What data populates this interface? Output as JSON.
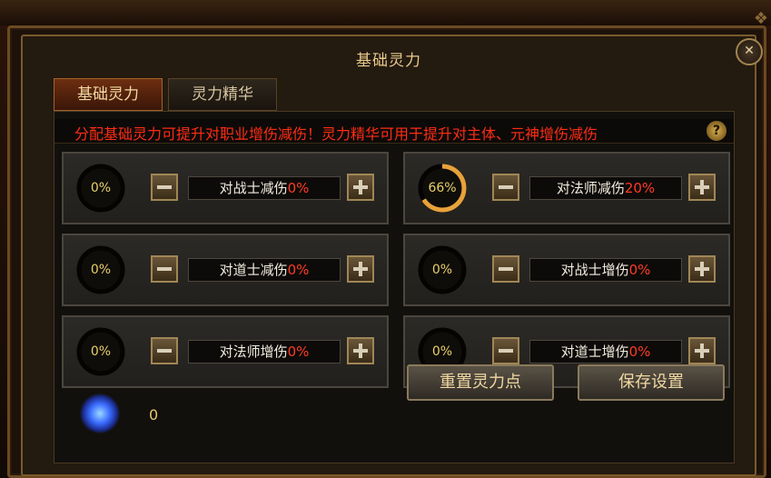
{
  "window": {
    "title": "基础灵力",
    "close_symbol": "✕"
  },
  "tabs": [
    {
      "label": "基础灵力",
      "active": true
    },
    {
      "label": "灵力精华",
      "active": false
    }
  ],
  "hint": {
    "text": "分配基础灵力可提升对职业增伤减伤！灵力精华可用于提升对主体、元神增伤减伤",
    "help_symbol": "?"
  },
  "stats": [
    {
      "percent_text": "0%",
      "progress": 0,
      "label": "对战士减伤",
      "value": "0%"
    },
    {
      "percent_text": "66%",
      "progress": 0.66,
      "label": "对法师减伤",
      "value": "20%"
    },
    {
      "percent_text": "0%",
      "progress": 0,
      "label": "对道士减伤",
      "value": "0%"
    },
    {
      "percent_text": "0%",
      "progress": 0,
      "label": "对战士增伤",
      "value": "0%"
    },
    {
      "percent_text": "0%",
      "progress": 0,
      "label": "对法师增伤",
      "value": "0%"
    },
    {
      "percent_text": "0%",
      "progress": 0,
      "label": "对道士增伤",
      "value": "0%"
    }
  ],
  "points": {
    "icon": "spirit-orb-icon",
    "count": "0"
  },
  "buttons": {
    "reset": "重置灵力点",
    "save": "保存设置"
  },
  "colors": {
    "accent": "#e8a23a",
    "value_red": "#ff3a26",
    "hint_red": "#ff2c14"
  }
}
